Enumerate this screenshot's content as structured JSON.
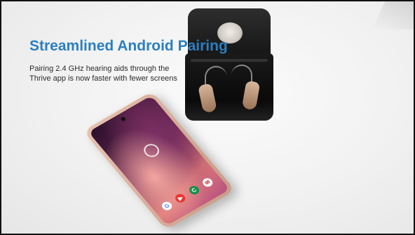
{
  "slide": {
    "title": "Streamlined Android Pairing",
    "body_line1": "Pairing 2.4 GHz hearing aids through the",
    "body_line2": "Thrive app is now faster with fewer screens"
  },
  "phone": {
    "status_time": "",
    "dock_icons": [
      "google-icon",
      "youtube-icon",
      "contacts-icon",
      "messages-icon"
    ]
  },
  "colors": {
    "title": "#2a7fc1",
    "text": "#2b2b2b",
    "frame": "#111111"
  }
}
